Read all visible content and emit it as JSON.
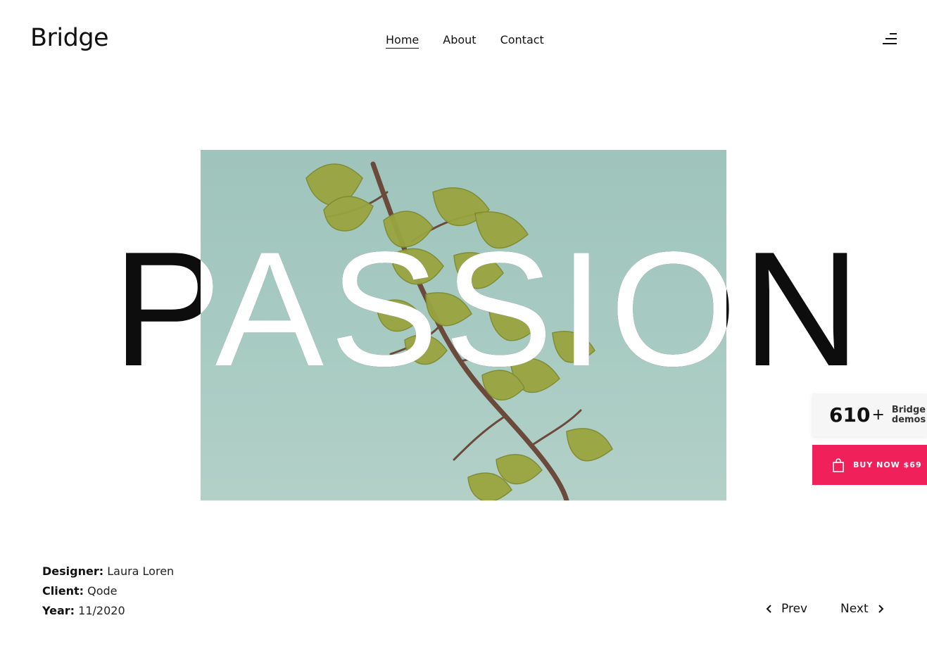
{
  "brand": {
    "logo": "Bridge"
  },
  "nav": {
    "items": [
      "Home",
      "About",
      "Contact"
    ],
    "active": "Home"
  },
  "hero": {
    "headline": "PASSION"
  },
  "project": {
    "designer_label": "Designer:",
    "designer": "Laura Loren",
    "client_label": "Client:",
    "client": "Qode",
    "year_label": "Year:",
    "year": "11/2020"
  },
  "pager": {
    "prev": "Prev",
    "next": "Next"
  },
  "promo": {
    "count": "610",
    "plus": "+",
    "label_line1": "Bridge",
    "label_line2": "demos",
    "buy_label": "BUY NOW $69"
  },
  "colors": {
    "accent": "#f0205a",
    "image_bg": "#a7cbc2",
    "leaf": "#9aa53f"
  },
  "icons": {
    "menu": "hamburger-icon",
    "bag": "shopping-bag-icon",
    "prev": "chevron-left-icon",
    "next": "chevron-right-icon"
  }
}
